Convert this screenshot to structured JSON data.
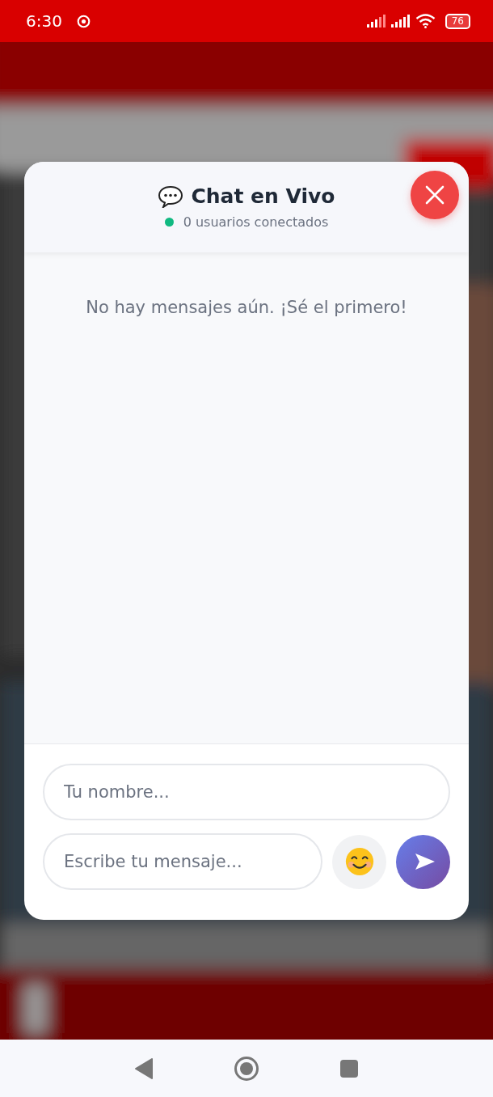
{
  "status_bar": {
    "time": "6:30",
    "battery": "76"
  },
  "chat": {
    "title": "Chat en Vivo",
    "online_count": "0 usuarios conectados",
    "empty_message": "No hay mensajes aún. ¡Sé el primero!",
    "name_field": {
      "placeholder": "Tu nombre..."
    },
    "message_field": {
      "placeholder": "Escribe tu mensaje..."
    }
  }
}
